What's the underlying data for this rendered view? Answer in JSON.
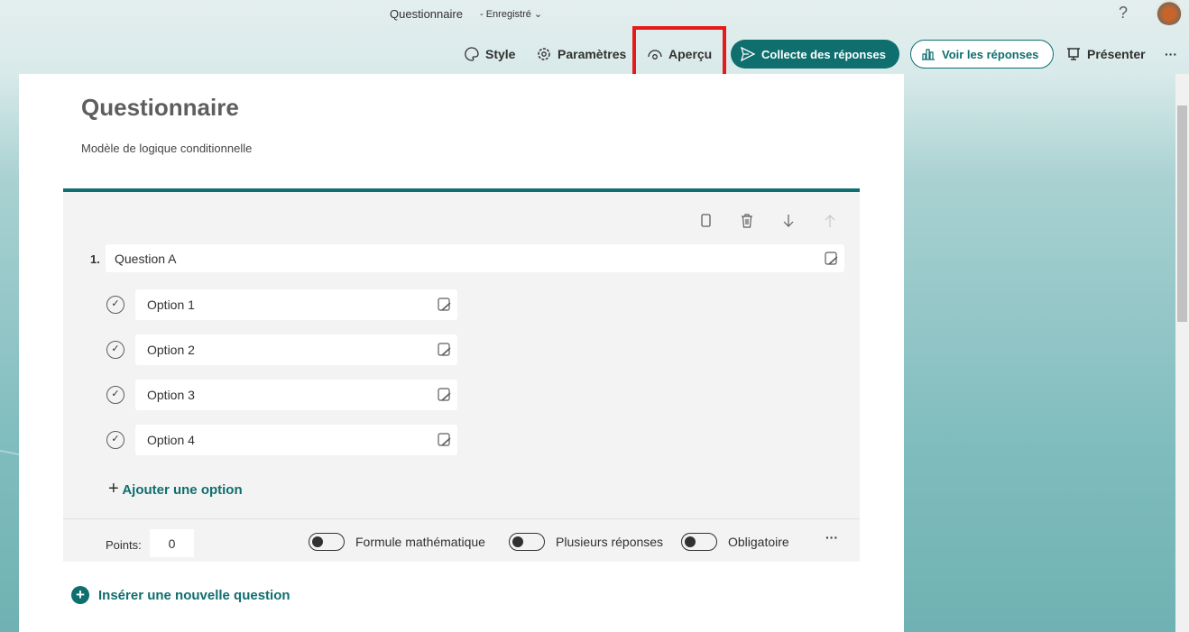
{
  "header": {
    "title": "Questionnaire",
    "status": "- Enregistré",
    "help": "?"
  },
  "toolbar": {
    "style": "Style",
    "settings": "Paramètres",
    "preview": "Aperçu",
    "collect": "Collecte des réponses",
    "view": "Voir les réponses",
    "present": "Présenter",
    "more": "···"
  },
  "form": {
    "title": "Questionnaire",
    "description": "Modèle de logique conditionnelle"
  },
  "question": {
    "number": "1.",
    "text": "Question A",
    "options": [
      "Option 1",
      "Option 2",
      "Option 3",
      "Option 4"
    ],
    "add_option": "Ajouter une option",
    "points_label": "Points:",
    "points": "0",
    "math": "Formule mathématique",
    "multiple": "Plusieurs réponses",
    "required": "Obligatoire",
    "more": "···"
  },
  "insert": "Insérer une nouvelle question",
  "colors": {
    "accent": "#0f6e6e",
    "highlight": "#e31b1b"
  }
}
